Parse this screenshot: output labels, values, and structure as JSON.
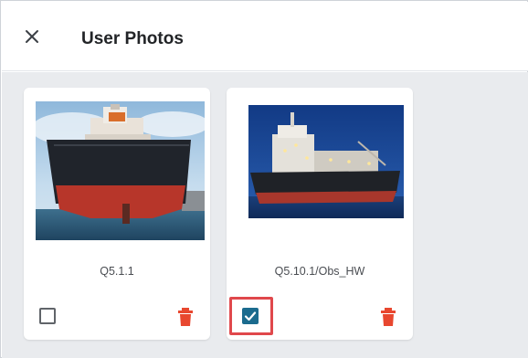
{
  "dialog": {
    "title": "User Photos",
    "close_icon": "close-icon"
  },
  "photos": [
    {
      "caption": "Q5.1.1",
      "selected": false,
      "delete_icon": "trash-icon"
    },
    {
      "caption": "Q5.10.1/Obs_HW",
      "selected": true,
      "delete_icon": "trash-icon"
    }
  ],
  "colors": {
    "accent": "#1b6b8e",
    "delete": "#e8472f",
    "highlight": "#e0484c",
    "background": "#e9ebee"
  }
}
